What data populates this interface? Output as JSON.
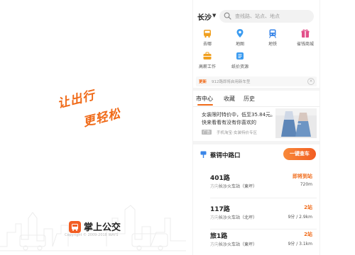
{
  "splash": {
    "slogan_line_1": "让出行",
    "slogan_line_2": "更轻松",
    "app_name": "掌上公交",
    "copyright": "Copyright © 2009-2018 WAYS",
    "brand_color": "#f06a18"
  },
  "topbar": {
    "city": "长沙",
    "search_placeholder": "查线路、站点、地点"
  },
  "nav": [
    {
      "label": "去哪",
      "icon": "bus-icon",
      "color": "#f0a020"
    },
    {
      "label": "地图",
      "icon": "map-pin-icon",
      "color": "#3a9bf0"
    },
    {
      "label": "地铁",
      "icon": "metro-icon",
      "color": "#3a86e8"
    },
    {
      "label": "省钱商城",
      "icon": "gift-icon",
      "color": "#e2508a"
    },
    {
      "label": "高薪工作",
      "icon": "briefcase-icon",
      "color": "#f0a020"
    },
    {
      "label": "纸价资源",
      "icon": "ticket-icon",
      "color": "#3a9bf0"
    }
  ],
  "notice": {
    "tag": "更新",
    "text": "912路即将启用新车型",
    "close": "×"
  },
  "tabs": [
    "市中心",
    "收藏",
    "历史"
  ],
  "ad": {
    "line_1": "女装限时特价中，低至35.84元。",
    "line_2": "快来看看有没有你喜欢的",
    "badge": "广告",
    "source": "手机淘宝-女装特价专区"
  },
  "stop": {
    "name": "蔡锷中路口",
    "button": "一键查车"
  },
  "routes": [
    {
      "name": "401路",
      "dir": "方向",
      "stop": "长沙火车站（東坪）",
      "status": "即将到站",
      "detail": "720m"
    },
    {
      "name": "117路",
      "dir": "方向",
      "stop": "长沙火车站（北坪）",
      "status": "2站",
      "detail": "9分 / 2.9km"
    },
    {
      "name": "旅1路",
      "dir": "方向",
      "stop": "长沙火车站（東坪）",
      "status": "2站",
      "detail": "9分 / 3.1km"
    }
  ]
}
